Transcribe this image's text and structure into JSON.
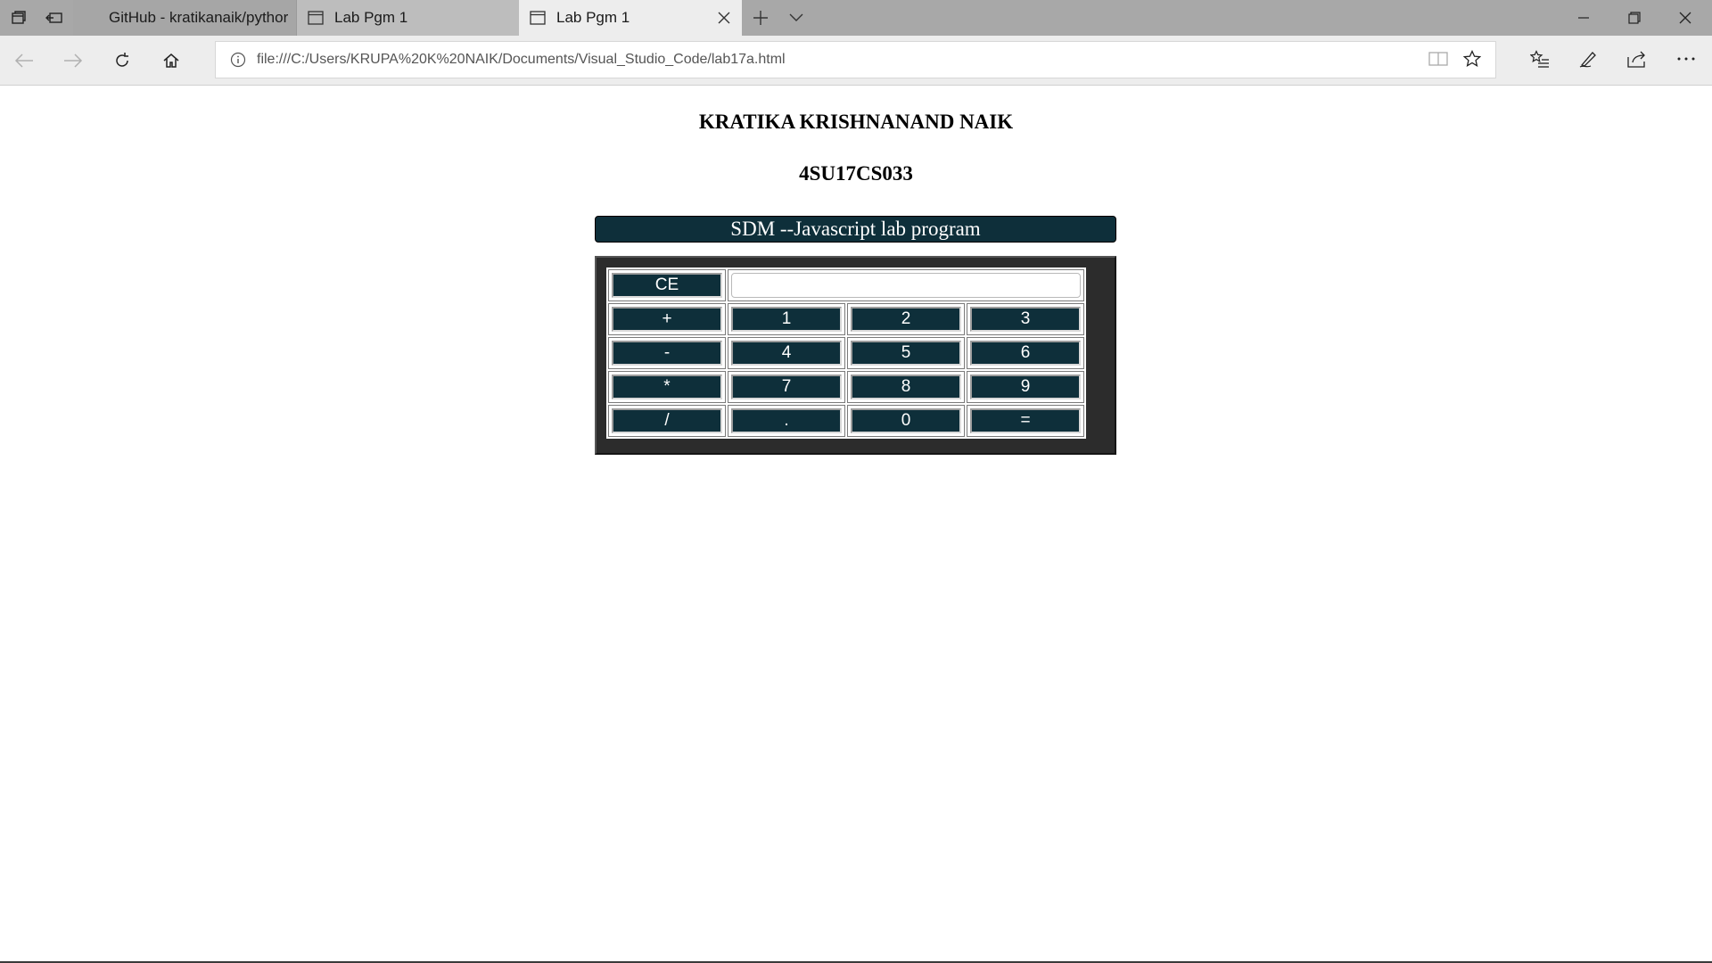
{
  "browser": {
    "tabs": [
      {
        "label": "GitHub - kratikanaik/pythor",
        "active": false
      },
      {
        "label": "Lab Pgm 1",
        "active": false
      },
      {
        "label": "Lab Pgm 1",
        "active": true
      }
    ],
    "address": {
      "url": "file:///C:/Users/KRUPA%20K%20NAIK/Documents/Visual_Studio_Code/lab17a.html"
    }
  },
  "page": {
    "name_heading": "KRATIKA KRISHNANAND NAIK",
    "usn_heading": "4SU17CS033",
    "banner": "SDM --Javascript lab program",
    "calculator": {
      "clear_label": "CE",
      "display_value": "",
      "rows": [
        [
          "+",
          "1",
          "2",
          "3"
        ],
        [
          "-",
          "4",
          "5",
          "6"
        ],
        [
          "*",
          "7",
          "8",
          "9"
        ],
        [
          "/",
          ".",
          "0",
          "="
        ]
      ]
    }
  },
  "colors": {
    "button_bg": "#0e2f3a",
    "calc_frame": "#2c2c2c"
  }
}
